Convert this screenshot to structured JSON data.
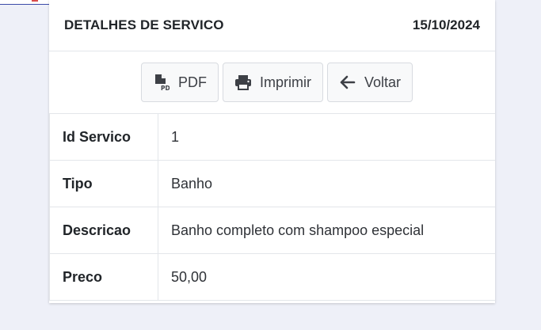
{
  "header": {
    "title": "DETALHES DE SERVICO",
    "date": "15/10/2024"
  },
  "toolbar": {
    "pdf_label": "PDF",
    "print_label": "Imprimir",
    "back_label": "Voltar"
  },
  "icons": {
    "pdf": "file-pdf-icon",
    "print": "printer-icon",
    "back": "arrow-left-icon"
  },
  "details": [
    {
      "label": "Id Servico",
      "value": "1"
    },
    {
      "label": "Tipo",
      "value": "Banho"
    },
    {
      "label": "Descricao",
      "value": "Banho completo com shampoo especial"
    },
    {
      "label": "Preco",
      "value": "50,00"
    }
  ],
  "colors": {
    "page_background": "#eef0f8",
    "card_background": "#ffffff",
    "button_background": "#f8f9fa"
  }
}
